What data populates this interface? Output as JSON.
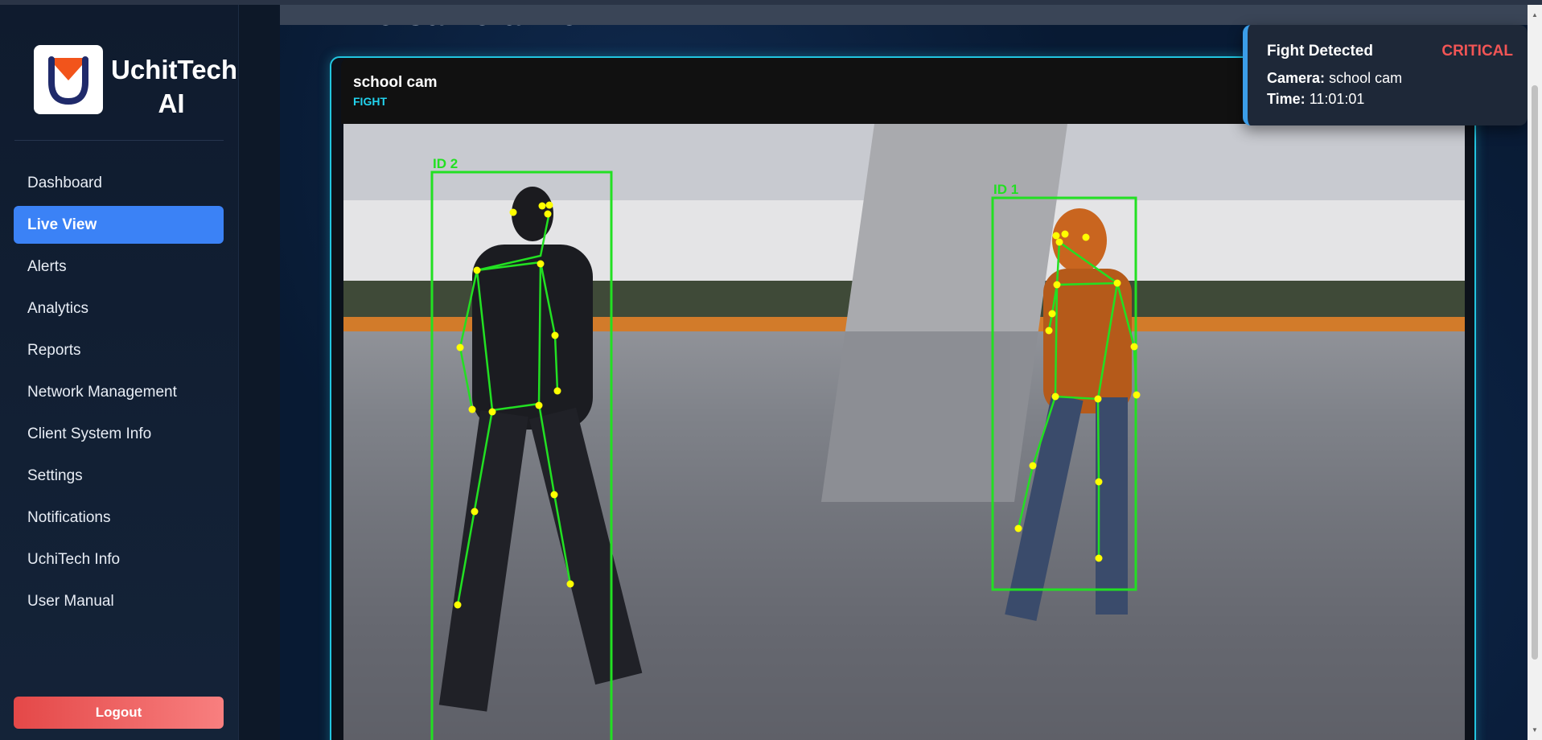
{
  "app": {
    "brand_line1": "UchitTech",
    "brand_line2": "AI"
  },
  "sidebar": {
    "items": [
      {
        "label": "Dashboard",
        "active": false
      },
      {
        "label": "Live View",
        "active": true
      },
      {
        "label": "Alerts",
        "active": false
      },
      {
        "label": "Analytics",
        "active": false
      },
      {
        "label": "Reports",
        "active": false
      },
      {
        "label": "Network Management",
        "active": false
      },
      {
        "label": "Client System Info",
        "active": false
      },
      {
        "label": "Settings",
        "active": false
      },
      {
        "label": "Notifications",
        "active": false
      },
      {
        "label": "UchiTech Info",
        "active": false
      },
      {
        "label": "User Manual",
        "active": false
      }
    ],
    "logout_label": "Logout"
  },
  "main": {
    "page_title": "Live Camera View",
    "camera": {
      "name": "school cam",
      "status": "FIGHT",
      "detections": [
        {
          "label": "ID 2"
        },
        {
          "label": "ID 1"
        }
      ]
    }
  },
  "toast": {
    "title": "Fight Detected",
    "severity": "CRITICAL",
    "camera_label": "Camera:",
    "camera_value": "school cam",
    "time_label": "Time:",
    "time_value": "11:01:01"
  },
  "colors": {
    "accent": "#3b82f6",
    "cyan": "#22c5e0",
    "critical": "#f25555",
    "detection": "#22e022",
    "keypoint": "#ffff00",
    "logo_orange": "#f2541b",
    "logo_navy": "#1f2a6a"
  }
}
